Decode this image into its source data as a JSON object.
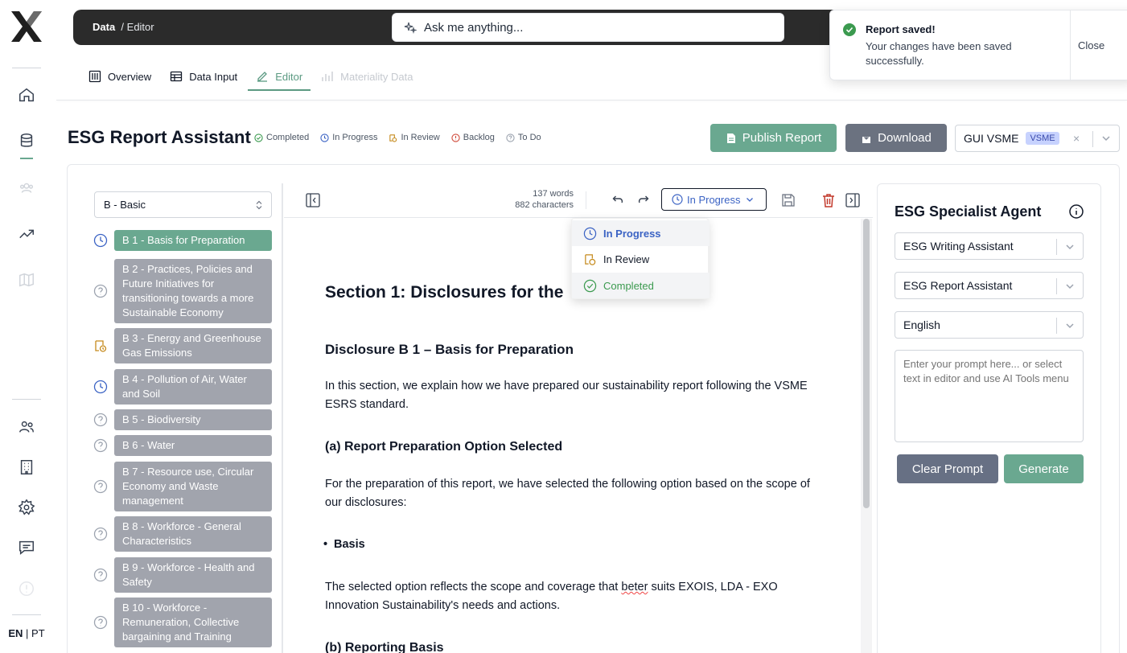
{
  "brand": {
    "logo_letter": "X"
  },
  "language": {
    "active": "EN",
    "separator": "|",
    "other": "PT"
  },
  "header": {
    "breadcrumb_root": "Data",
    "breadcrumb_current": "/ Editor",
    "ask_placeholder": "Ask me anything..."
  },
  "tabs": [
    {
      "label": "Overview",
      "icon": "columns-icon"
    },
    {
      "label": "Data Input",
      "icon": "table-icon"
    },
    {
      "label": "Editor",
      "icon": "pencil-icon"
    },
    {
      "label": "Materiality Data",
      "icon": "bar-chart-icon"
    }
  ],
  "page": {
    "title": "ESG Report Assistant",
    "legend": [
      {
        "label": "Completed",
        "color": "#3b9a4f"
      },
      {
        "label": "In Progress",
        "color": "#3b63c4"
      },
      {
        "label": "In Review",
        "color": "#c58a1c"
      },
      {
        "label": "Backlog",
        "color": "#d04a3a"
      },
      {
        "label": "To Do",
        "color": "#9ca3af"
      }
    ],
    "publish_label": "Publish Report",
    "download_label": "Download",
    "report_name": "GUI VSME",
    "report_badge": "VSME",
    "clear_symbol": "×"
  },
  "sections": {
    "selected": "B - Basic",
    "items": [
      {
        "label": "B 1 - Basis for Preparation",
        "status": "in-progress"
      },
      {
        "label": "B 2 - Practices, Policies and Future Initiatives for transitioning towards a more Sustainable Economy",
        "status": "todo"
      },
      {
        "label": "B 3 - Energy and Greenhouse Gas Emissions",
        "status": "in-review"
      },
      {
        "label": "B 4 - Pollution of Air, Water and Soil",
        "status": "in-progress"
      },
      {
        "label": "B 5 - Biodiversity",
        "status": "todo"
      },
      {
        "label": "B 6 - Water",
        "status": "todo"
      },
      {
        "label": "B 7 - Resource use, Circular Economy and Waste management",
        "status": "todo"
      },
      {
        "label": "B 8 - Workforce - General Characteristics",
        "status": "todo"
      },
      {
        "label": "B 9 - Workforce - Health and Safety",
        "status": "todo"
      },
      {
        "label": "B 10 - Workforce - Remuneration, Collective bargaining and Training",
        "status": "todo"
      }
    ]
  },
  "editor": {
    "word_count": "137 words",
    "char_count": "882 characters",
    "status_label": "In Progress",
    "status_options": [
      "In Progress",
      "In Review",
      "Completed"
    ],
    "h1": "Section 1: Disclosures for the",
    "h2": "Disclosure B 1 – Basis for Preparation",
    "p1": "In this section, we explain how we have prepared our sustainability report following the VSME ESRS standard.",
    "h3a": "(a) Report Preparation Option Selected",
    "p2": "For the preparation of this report, we have selected the following option based on the scope of our disclosures:",
    "bullet": "Basis",
    "p3_before": "The selected option reflects the scope and coverage that ",
    "p3_misspelled": "beter",
    "p3_after": " suits EXOIS, LDA - EXO Innovation Sustainability's needs and actions.",
    "h3b": "(b) Reporting Basis"
  },
  "agent": {
    "title": "ESG Specialist Agent",
    "assistant": "ESG Writing Assistant",
    "template": "ESG Report Assistant",
    "language": "English",
    "prompt_placeholder": "Enter your prompt here... or select text in editor and use AI Tools menu",
    "clear_label": "Clear Prompt",
    "generate_label": "Generate"
  },
  "toast": {
    "title": "Report saved!",
    "message": "Your changes have been saved successfully.",
    "close_label": "Close"
  }
}
